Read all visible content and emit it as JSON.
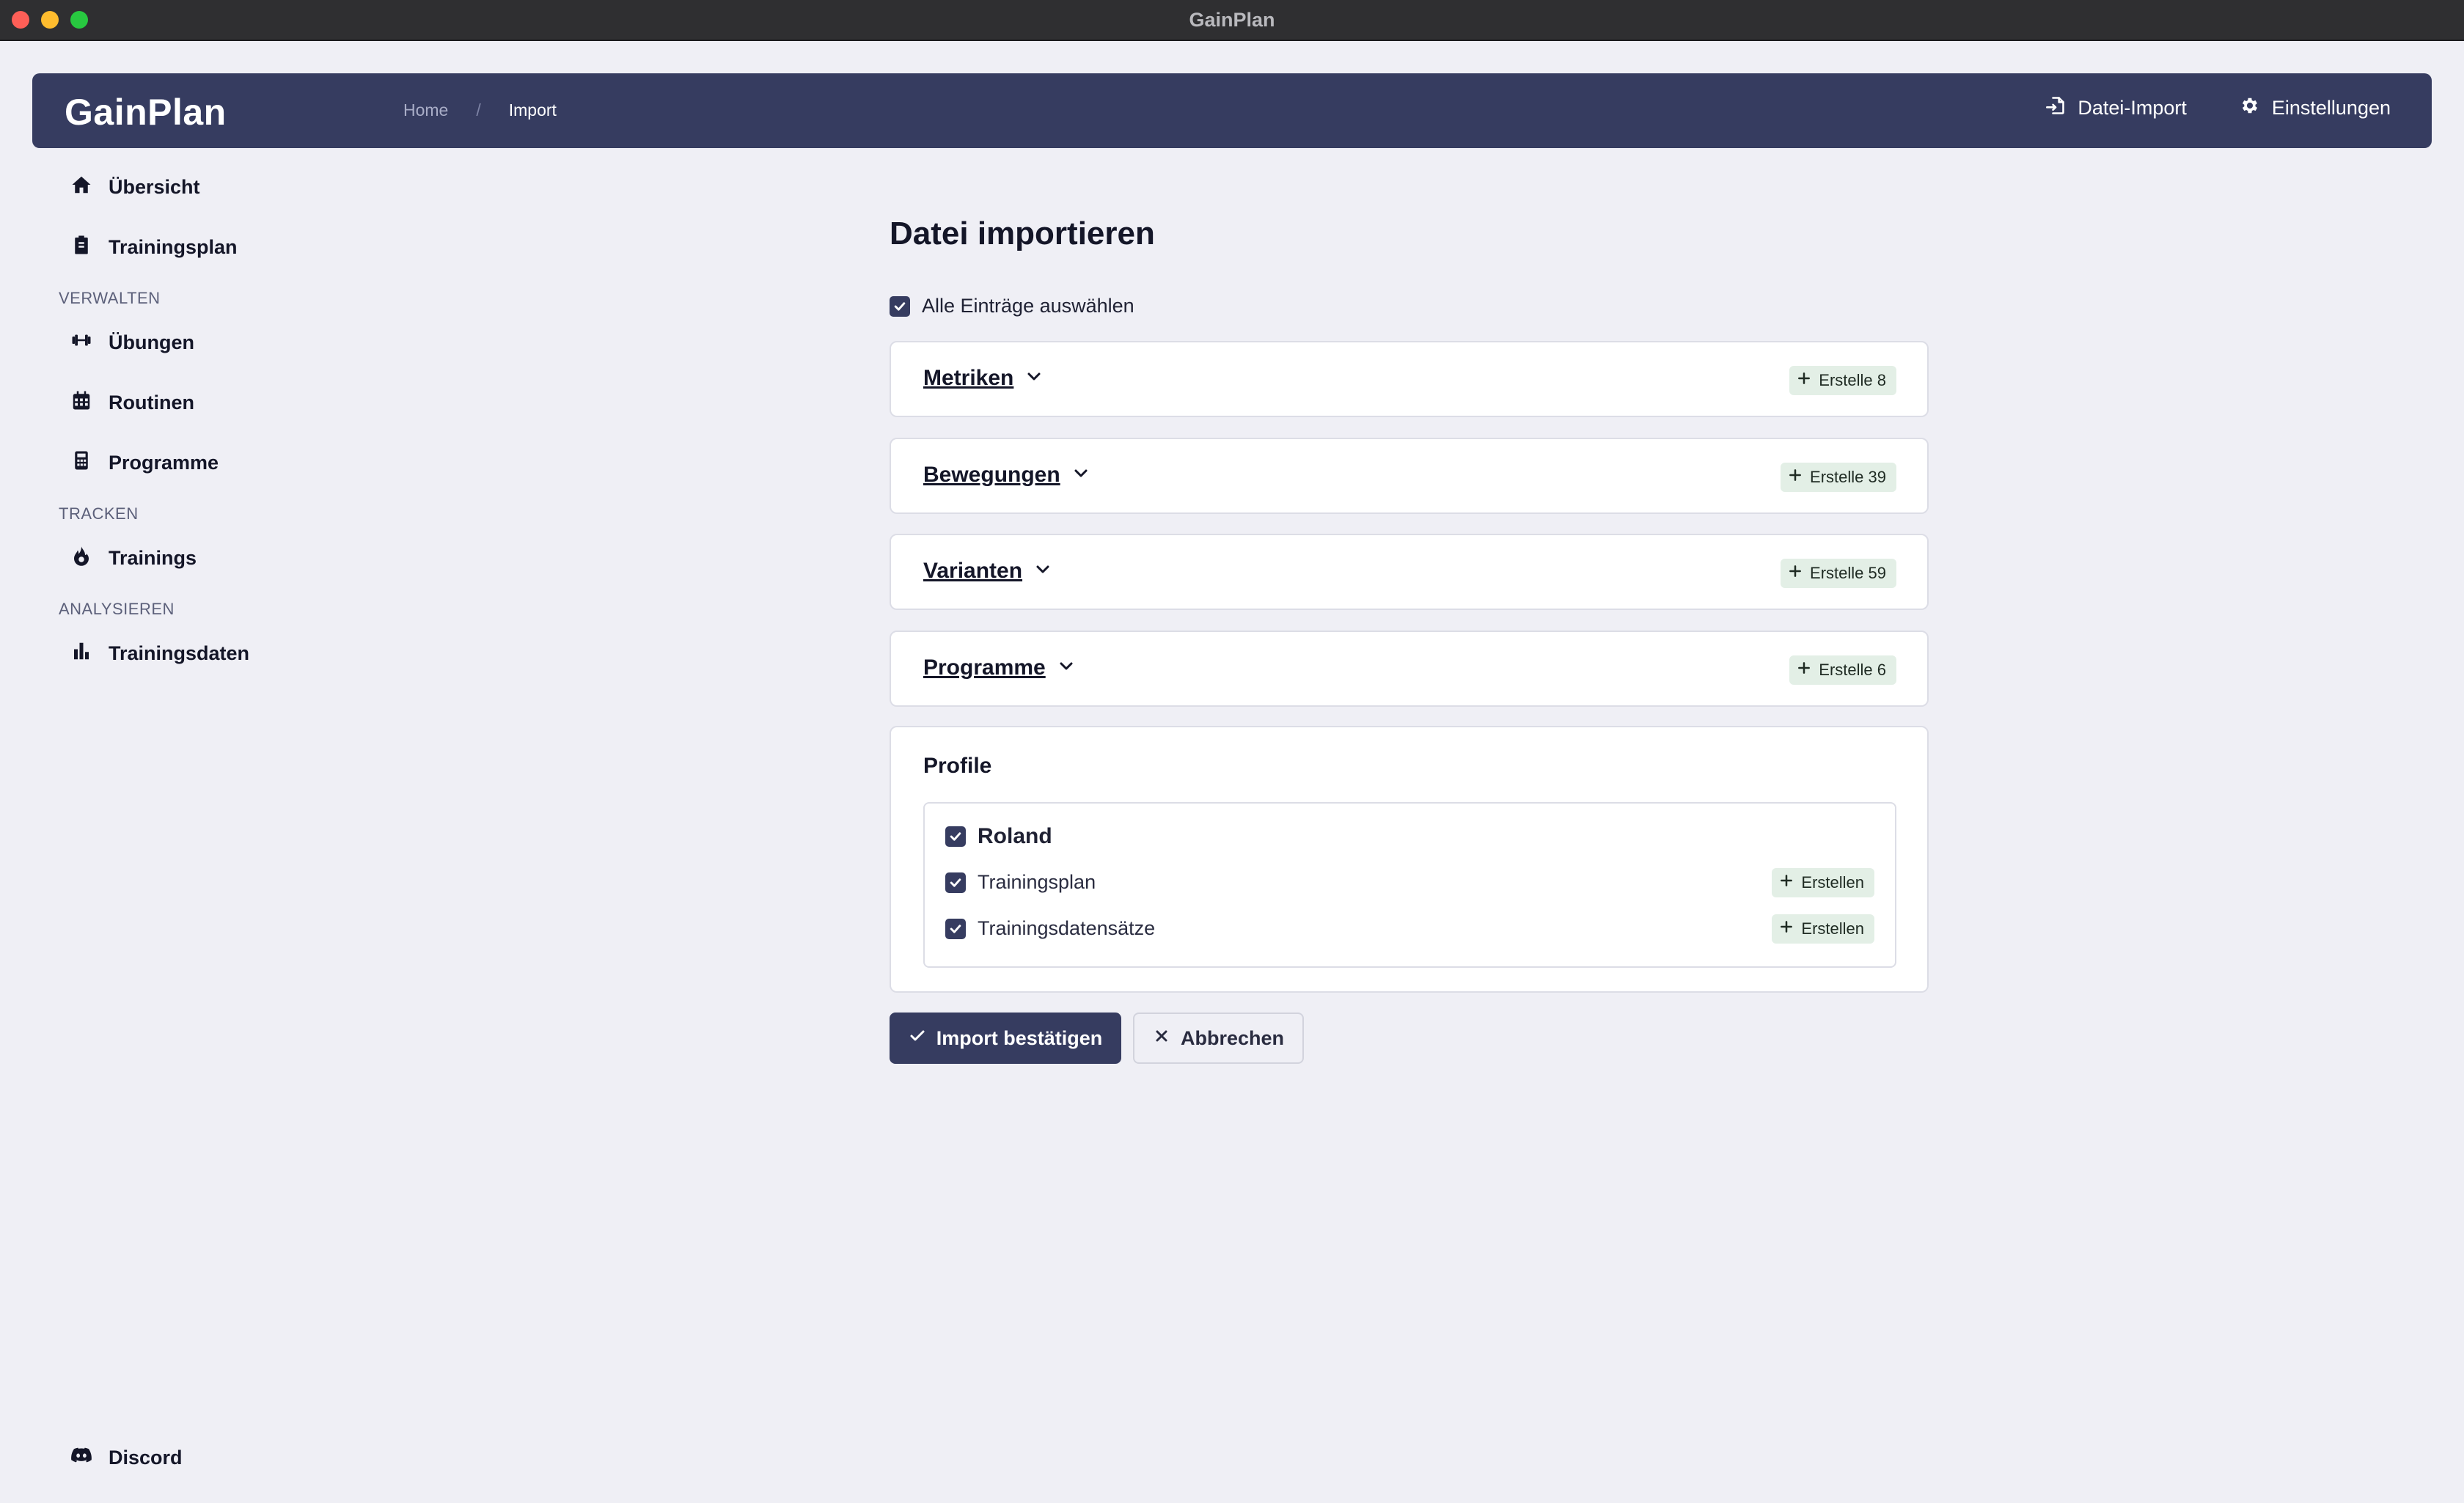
{
  "window": {
    "title": "GainPlan"
  },
  "header": {
    "logo": "GainPlan",
    "breadcrumb": {
      "home": "Home",
      "separator": "/",
      "current": "Import"
    },
    "actions": {
      "import": "Datei-Import",
      "settings": "Einstellungen"
    }
  },
  "sidebar": {
    "top_items": [
      {
        "label": "Übersicht",
        "icon": "home-icon"
      },
      {
        "label": "Trainingsplan",
        "icon": "clipboard-icon"
      }
    ],
    "sections": [
      {
        "title": "VERWALTEN",
        "items": [
          {
            "label": "Übungen",
            "icon": "dumbbell-icon"
          },
          {
            "label": "Routinen",
            "icon": "calendar-icon"
          },
          {
            "label": "Programme",
            "icon": "calculator-icon"
          }
        ]
      },
      {
        "title": "TRACKEN",
        "items": [
          {
            "label": "Trainings",
            "icon": "flame-icon"
          }
        ]
      },
      {
        "title": "ANALYSIEREN",
        "items": [
          {
            "label": "Trainingsdaten",
            "icon": "bar-chart-icon"
          }
        ]
      }
    ],
    "footer": {
      "label": "Discord",
      "icon": "discord-icon"
    }
  },
  "main": {
    "title": "Datei importieren",
    "select_all": {
      "label": "Alle Einträge auswählen",
      "checked": true
    },
    "accordions": [
      {
        "label": "Metriken",
        "badge": "Erstelle 8"
      },
      {
        "label": "Bewegungen",
        "badge": "Erstelle 39"
      },
      {
        "label": "Varianten",
        "badge": "Erstelle 59"
      },
      {
        "label": "Programme",
        "badge": "Erstelle 6"
      }
    ],
    "profiles": {
      "heading": "Profile",
      "user": {
        "name": "Roland",
        "checked": true
      },
      "rows": [
        {
          "label": "Trainingsplan",
          "badge": "Erstellen",
          "checked": true
        },
        {
          "label": "Trainingsdatensätze",
          "badge": "Erstellen",
          "checked": true
        }
      ]
    },
    "buttons": {
      "confirm": "Import bestätigen",
      "cancel": "Abbrechen"
    }
  },
  "colors": {
    "primary": "#363c60",
    "background": "#efeff5",
    "badge_bg": "#e3efe6"
  }
}
